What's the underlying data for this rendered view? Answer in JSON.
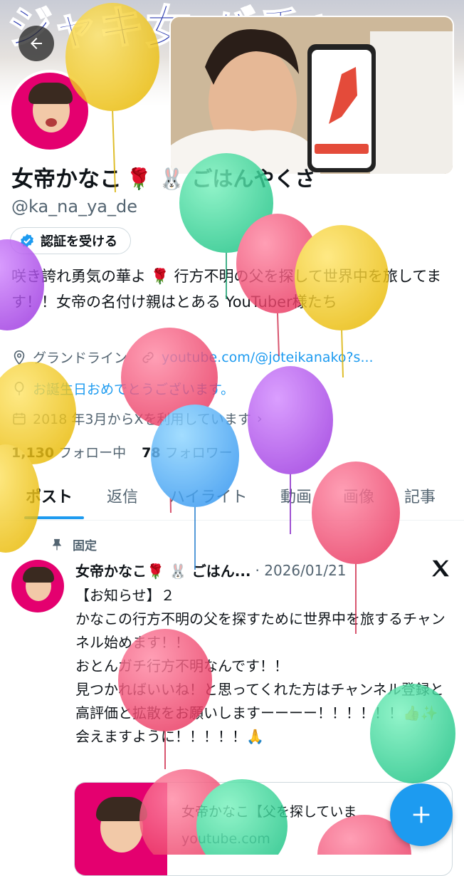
{
  "banner": {
    "text": "ジャキ女 バチャ"
  },
  "profile": {
    "display_name": "女帝かなこ",
    "display_name_rest": "🌹 🐰 ごはんやくさ",
    "handle": "@ka_na_ya_de",
    "verify_label": "認証を受ける",
    "bio": "咲き誇れ勇気の華よ 🌹 行方不明の父を探して世界中を旅してます！！女帝の名付け親はとある YouTuber様たち",
    "location": "グランドライン",
    "link": "youtube.com/@joteikanako?s...",
    "birthday": "お誕生日おめでとうございます。",
    "joined": "2018 年3月からXを利用しています",
    "following_count": "1,130",
    "following_label": "フォロー中",
    "followers_count": "78",
    "followers_label": "フォロワー"
  },
  "tabs": [
    {
      "label": "ポスト"
    },
    {
      "label": "返信"
    },
    {
      "label": "ハイライト"
    },
    {
      "label": "動画"
    },
    {
      "label": "画像"
    },
    {
      "label": "記事"
    }
  ],
  "post": {
    "pinned_label": "固定",
    "author": "女帝かなこ🌹 🐰 ごはん...",
    "date": "· 2026/01/21",
    "body": "【お知らせ】２\nかなこの行方不明の父を探すために世界中を旅するチャンネル始めます！！\nおとんガチ行方不明なんです！！\n見つかればいいね！と思ってくれた方はチャンネル登録と高評価と拡散をお願いしますーーーー！！！！！！👍✨\n会えますように！！！！！🙏",
    "card_title": "女帝かなこ【父を探していま",
    "card_domain": "youtube.com"
  },
  "icons": {
    "back": "arrow-left-icon",
    "verified": "verified-badge-icon",
    "location": "location-pin-icon",
    "link": "link-icon",
    "birthday": "balloon-icon",
    "calendar": "calendar-icon",
    "pin": "pin-icon",
    "x_logo": "x-logo-icon",
    "compose": "plus-icon"
  },
  "colors": {
    "accent": "#1d9bf0",
    "text": "#0f1419",
    "secondary": "#536471",
    "avatar_bg": "#e4006f"
  }
}
